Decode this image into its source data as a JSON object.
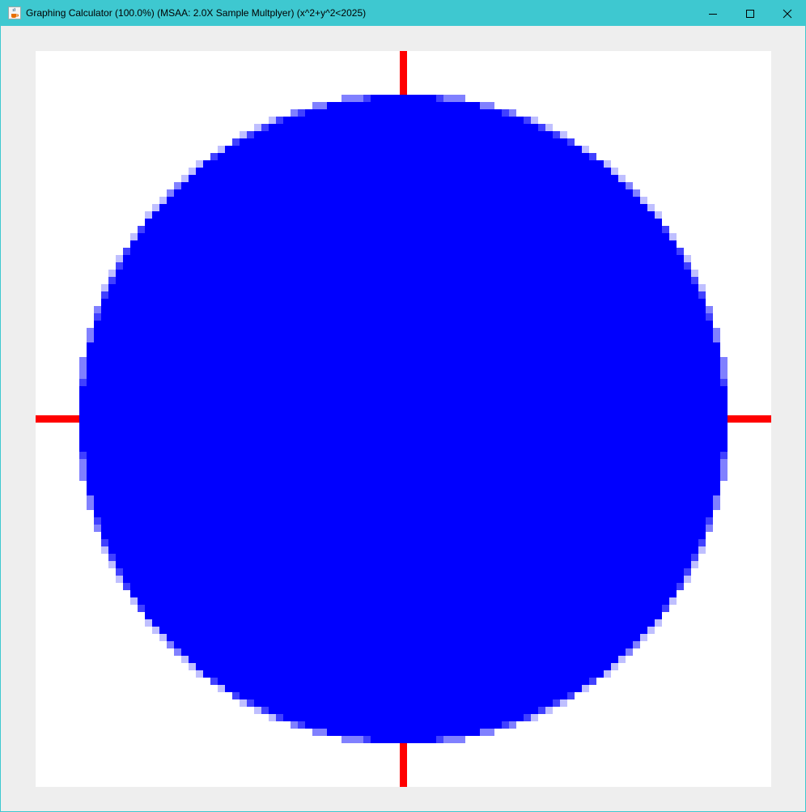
{
  "window": {
    "title": "Graphing Calculator (100.0%) (MSAA: 2.0X Sample Multplyer) (x^2+y^2<2025)",
    "icon": "java-cup-icon",
    "controls": {
      "minimize_icon": "minimize-icon",
      "maximize_icon": "maximize-icon",
      "close_icon": "close-icon"
    }
  },
  "chart_data": {
    "type": "region",
    "inequality": "x^2+y^2<2025",
    "radius": 45,
    "xlim": [
      -51,
      51
    ],
    "ylim": [
      -51,
      51
    ],
    "grid_cells": 101,
    "msaa_samples": 2,
    "region_color": "#0000ff",
    "axis_color": "#ff0000",
    "background_color": "#ffffff"
  }
}
